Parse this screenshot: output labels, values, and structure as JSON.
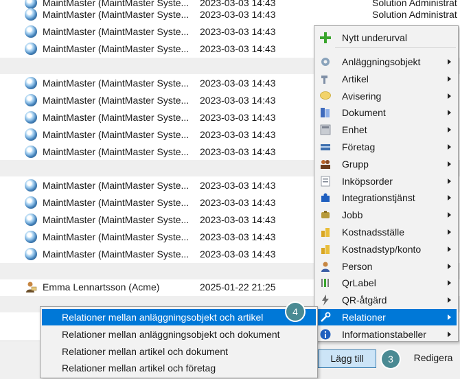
{
  "rows": [
    {
      "name": "MaintMaster (MaintMaster Syste...",
      "date": "2023-03-03 14:43",
      "user": "Solution Administrat"
    },
    {
      "name": "MaintMaster (MaintMaster Syste...",
      "date": "2023-03-03 14:43",
      "user": "Solution Administrat"
    },
    {
      "name": "MaintMaster (MaintMaster Syste...",
      "date": "2023-03-03 14:43",
      "user": ""
    },
    {
      "name": "MaintMaster (MaintMaster Syste...",
      "date": "2023-03-03 14:43",
      "user": ""
    },
    {
      "name": "MaintMaster (MaintMaster Syste...",
      "date": "2023-03-03 14:43",
      "user": ""
    },
    {
      "name": "MaintMaster (MaintMaster Syste...",
      "date": "2023-03-03 14:43",
      "user": ""
    },
    {
      "name": "MaintMaster (MaintMaster Syste...",
      "date": "2023-03-03 14:43",
      "user": ""
    },
    {
      "name": "MaintMaster (MaintMaster Syste...",
      "date": "2023-03-03 14:43",
      "user": ""
    },
    {
      "name": "MaintMaster (MaintMaster Syste...",
      "date": "2023-03-03 14:43",
      "user": ""
    },
    {
      "name": "MaintMaster (MaintMaster Syste...",
      "date": "2023-03-03 14:43",
      "user": ""
    },
    {
      "name": "MaintMaster (MaintMaster Syste...",
      "date": "2023-03-03 14:43",
      "user": ""
    },
    {
      "name": "MaintMaster (MaintMaster Syste...",
      "date": "2023-03-03 14:43",
      "user": ""
    },
    {
      "name": "MaintMaster (MaintMaster Syste...",
      "date": "2023-03-03 14:43",
      "user": ""
    },
    {
      "name": "MaintMaster (MaintMaster Syste...",
      "date": "2023-03-03 14:43",
      "user": ""
    },
    {
      "name": "MaintMaster (MaintMaster Syste...",
      "date": "2023-03-03 14:43",
      "user": ""
    },
    {
      "name": "Emma Lennartsson (Acme)",
      "date": "2025-01-22 21:25",
      "user": ""
    }
  ],
  "context_menu": {
    "items": [
      {
        "label": "Nytt underurval",
        "icon": "green-plus-icon",
        "submenu": false
      },
      {
        "label": "Anläggningsobjekt",
        "icon": "gear-icon",
        "submenu": true
      },
      {
        "label": "Artikel",
        "icon": "tools-icon",
        "submenu": true
      },
      {
        "label": "Avisering",
        "icon": "speech-bubble-icon",
        "submenu": true
      },
      {
        "label": "Dokument",
        "icon": "document-icon",
        "submenu": true
      },
      {
        "label": "Enhet",
        "icon": "calculator-icon",
        "submenu": true
      },
      {
        "label": "Företag",
        "icon": "building-icon",
        "submenu": true
      },
      {
        "label": "Grupp",
        "icon": "group-icon",
        "submenu": true
      },
      {
        "label": "Inköpsorder",
        "icon": "order-icon",
        "submenu": true
      },
      {
        "label": "Integrationstjänst",
        "icon": "puzzle-icon",
        "submenu": true
      },
      {
        "label": "Jobb",
        "icon": "job-icon",
        "submenu": true
      },
      {
        "label": "Kostnadsställe",
        "icon": "coins-icon",
        "submenu": true
      },
      {
        "label": "Kostnadstyp/konto",
        "icon": "coins-icon",
        "submenu": true
      },
      {
        "label": "Person",
        "icon": "person-icon",
        "submenu": true
      },
      {
        "label": "QrLabel",
        "icon": "barcode-icon",
        "submenu": true
      },
      {
        "label": "QR-åtgärd",
        "icon": "lightning-icon",
        "submenu": true
      },
      {
        "label": "Relationer",
        "icon": "wrench-link-icon",
        "submenu": true
      },
      {
        "label": "Informationstabeller",
        "icon": "info-icon",
        "submenu": true
      }
    ]
  },
  "submenu": {
    "items": [
      "Relationer mellan anläggningsobjekt och artikel",
      "Relationer mellan anläggningsobjekt och dokument",
      "Relationer mellan artikel och dokument",
      "Relationer mellan artikel och företag"
    ]
  },
  "buttons": {
    "add": "Lägg till",
    "edit": "Redigera"
  },
  "badges": {
    "first": "3",
    "second": "4"
  },
  "colors": {
    "highlight": "#0078d7",
    "badge": "#4a8a93",
    "selected_button": "#cce4f7"
  }
}
